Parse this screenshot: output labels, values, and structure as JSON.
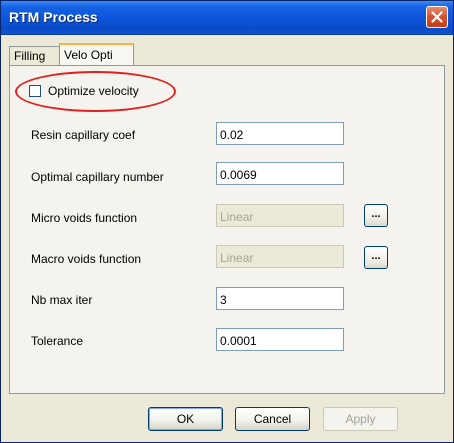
{
  "window": {
    "title": "RTM Process"
  },
  "tabs": [
    {
      "label": "Filling"
    },
    {
      "label": "Velo Opti"
    }
  ],
  "optimize": {
    "label": "Optimize velocity",
    "checked": false
  },
  "fields": [
    {
      "label": "Resin capillary coef",
      "value": "0.02"
    },
    {
      "label": "Optimal capillary number",
      "value": "0.0069"
    },
    {
      "label": "Micro voids function",
      "value": "Linear",
      "button": "..."
    },
    {
      "label": "Macro voids function",
      "value": "Linear",
      "button": "..."
    },
    {
      "label": "Nb max iter",
      "value": "3"
    },
    {
      "label": "Tolerance",
      "value": "0.0001"
    }
  ],
  "footer": {
    "ok": "OK",
    "cancel": "Cancel",
    "apply": "Apply"
  }
}
